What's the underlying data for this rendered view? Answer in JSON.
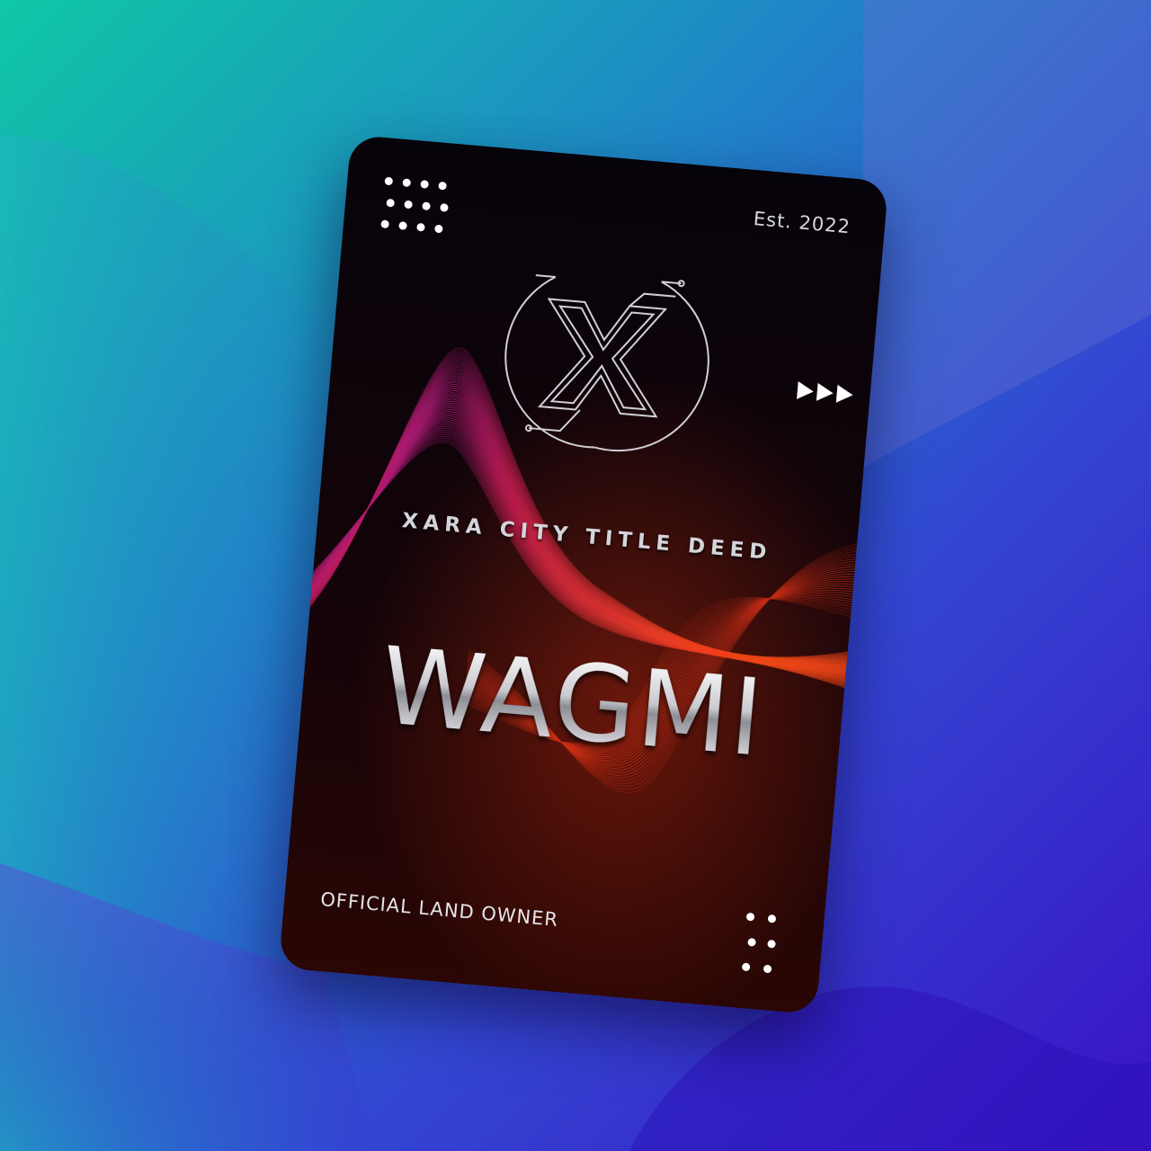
{
  "card": {
    "established": "Est. 2022",
    "subtitle": "XARA CITY TITLE DEED",
    "headline": "WAGMI",
    "footer": "OFFICIAL LAND OWNER"
  },
  "icons": {
    "logo": "xara-x-circle-logo",
    "top_left": "dot-grid-icon",
    "bottom_right": "dot-grid-icon",
    "arrows": "fast-forward-icon"
  },
  "colors": {
    "background_top_left": "#10c7a8",
    "background_bottom_right": "#3a12c8",
    "card_base": "#0a0408",
    "wave_magenta": "#c0208a",
    "wave_red": "#ff3a1a",
    "text_silver": "#d8d8dc"
  }
}
